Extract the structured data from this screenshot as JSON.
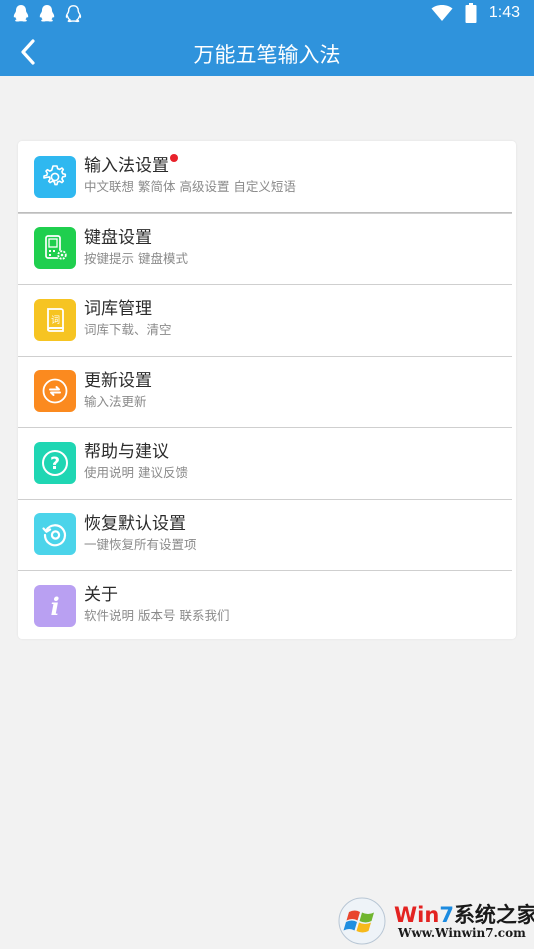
{
  "status_bar": {
    "time": "1:43",
    "left_icons": [
      "qq-icon",
      "qq-icon",
      "qq-outline-icon"
    ],
    "right_icons": [
      "wifi-icon",
      "battery-icon"
    ],
    "color": "#2f93dc"
  },
  "app_bar": {
    "title": "万能五笔输入法",
    "back_icon": "back-arrow-icon",
    "color": "#2f93dc"
  },
  "menu": {
    "items": [
      {
        "title": "输入法设置",
        "subtitle": "中文联想 繁简体 高级设置 自定义短语",
        "icon": "gear-icon",
        "icon_color": "#2fb8f0",
        "badge": true
      },
      {
        "title": "键盘设置",
        "subtitle": "按键提示 键盘模式",
        "icon": "keyboard-settings-icon",
        "icon_color": "#1fcf4e",
        "badge": false
      },
      {
        "title": "词库管理",
        "subtitle": "词库下载、清空",
        "icon": "dictionary-icon",
        "icon_color": "#f6c422",
        "badge": false,
        "icon_glyph": "词"
      },
      {
        "title": "更新设置",
        "subtitle": "输入法更新",
        "icon": "update-icon",
        "icon_color": "#fb8a1f",
        "badge": false
      },
      {
        "title": "帮助与建议",
        "subtitle": "使用说明 建议反馈",
        "icon": "help-icon",
        "icon_color": "#1fd6b3",
        "badge": false,
        "icon_glyph": "?"
      },
      {
        "title": "恢复默认设置",
        "subtitle": "一键恢复所有设置项",
        "icon": "restore-icon",
        "icon_color": "#4bd4ea",
        "badge": false
      },
      {
        "title": "关于",
        "subtitle": "软件说明 版本号 联系我们",
        "icon": "info-icon",
        "icon_color": "#b9a0f2",
        "badge": false,
        "icon_glyph": "i"
      }
    ]
  },
  "watermark": {
    "brand": "Win7系统之家",
    "url": "Www.Winwin7.com",
    "colors": {
      "win": "#e32321",
      "seven": "#1c8be0",
      "rest": "#1a1a1a"
    }
  }
}
